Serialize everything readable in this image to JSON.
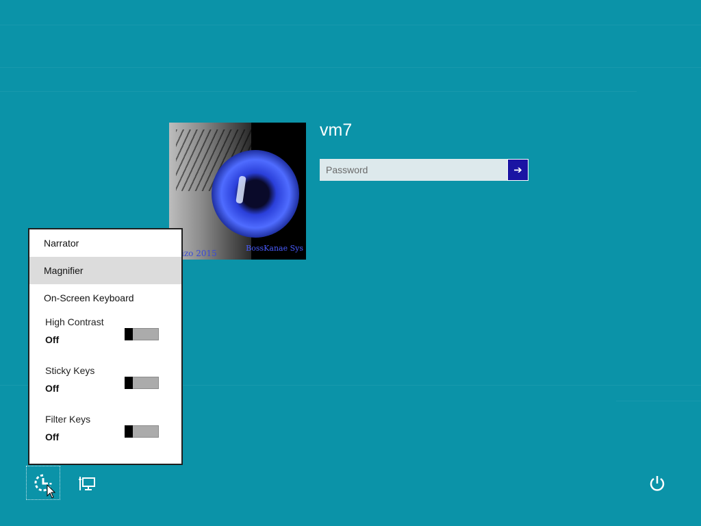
{
  "user": {
    "name": "vm7",
    "tile_caption_left": "izo 2015",
    "tile_caption_right": "BossKanae Sys"
  },
  "login": {
    "password_placeholder": "Password",
    "submit_icon": "arrow-right-icon",
    "submit_glyph": "➔"
  },
  "ease_menu": {
    "items": [
      {
        "label": "Narrator"
      },
      {
        "label": "Magnifier"
      },
      {
        "label": "On-Screen Keyboard"
      }
    ],
    "toggles": [
      {
        "label": "High Contrast",
        "state": "Off"
      },
      {
        "label": "Sticky Keys",
        "state": "Off"
      },
      {
        "label": "Filter Keys",
        "state": "Off"
      }
    ]
  },
  "bottom_bar": {
    "ease_of_access_icon": "ease-of-access-icon",
    "network_icon": "network-icon",
    "power_icon": "power-icon"
  },
  "colors": {
    "background": "#0b93a8",
    "submit_button": "#1a14a3",
    "menu_hover": "#dcdcdc"
  }
}
